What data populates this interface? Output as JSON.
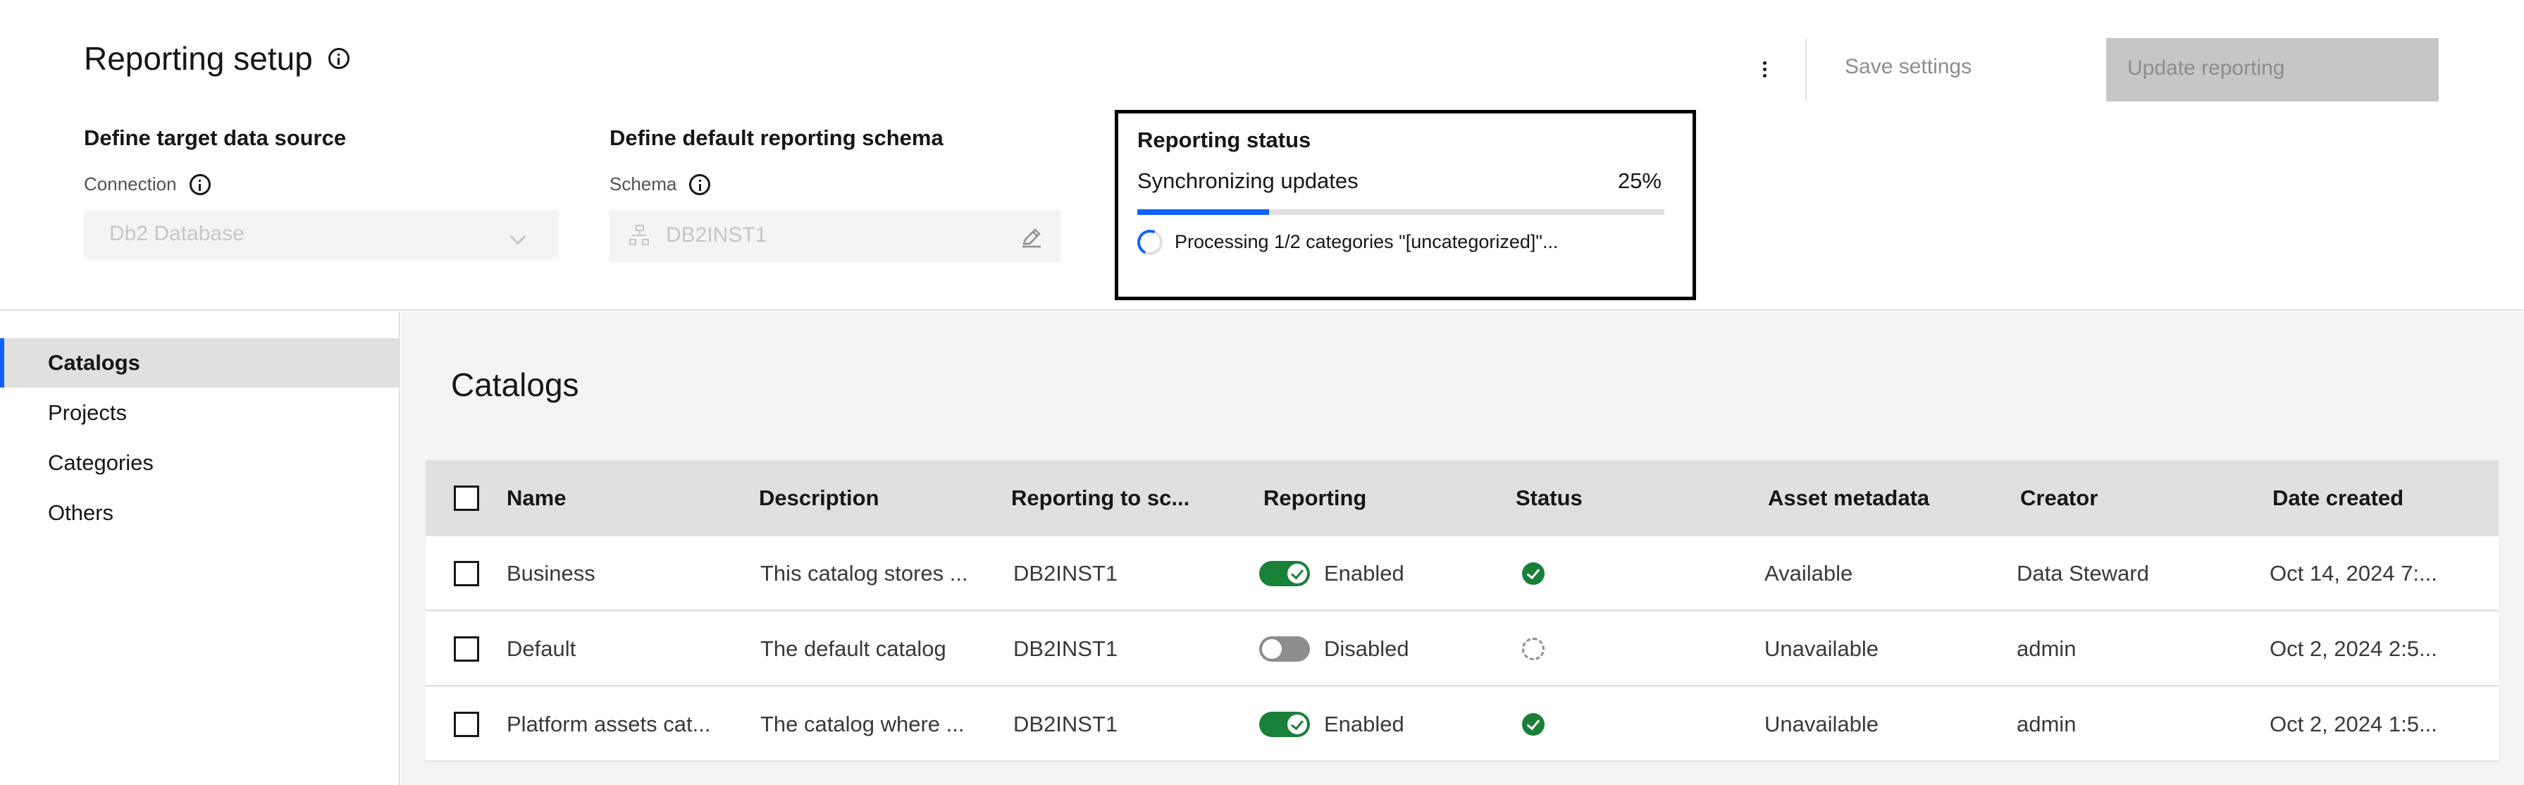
{
  "header": {
    "title": "Reporting setup",
    "save_label": "Save settings",
    "update_label": "Update reporting",
    "target": {
      "heading": "Define target data source",
      "field_label": "Connection",
      "value": "Db2 Database"
    },
    "schema": {
      "heading": "Define default reporting schema",
      "field_label": "Schema",
      "value": "DB2INST1"
    },
    "status_card": {
      "title": "Reporting status",
      "subtitle": "Synchronizing updates",
      "percent_text": "25%",
      "progress": 0.25,
      "message": "Processing 1/2 categories \"[uncategorized]\"..."
    }
  },
  "sidebar": {
    "items": [
      {
        "label": "Catalogs",
        "active": true
      },
      {
        "label": "Projects",
        "active": false
      },
      {
        "label": "Categories",
        "active": false
      },
      {
        "label": "Others",
        "active": false
      }
    ]
  },
  "main": {
    "title": "Catalogs",
    "columns": [
      "Name",
      "Description",
      "Reporting to sc...",
      "Reporting",
      "Status",
      "Asset metadata",
      "Creator",
      "Date created"
    ],
    "rows": [
      {
        "name": "Business",
        "description": "This catalog stores ...",
        "schema": "DB2INST1",
        "reporting": "Enabled",
        "reporting_on": true,
        "status": "synced",
        "asset_metadata": "Available",
        "creator": "Data Steward",
        "date": "Oct 14, 2024 7:..."
      },
      {
        "name": "Default",
        "description": "The default catalog",
        "schema": "DB2INST1",
        "reporting": "Disabled",
        "reporting_on": false,
        "status": "not-synced",
        "asset_metadata": "Unavailable",
        "creator": "admin",
        "date": "Oct 2, 2024 2:5..."
      },
      {
        "name": "Platform assets cat...",
        "description": "The catalog where ...",
        "schema": "DB2INST1",
        "reporting": "Enabled",
        "reporting_on": true,
        "status": "synced",
        "asset_metadata": "Unavailable",
        "creator": "admin",
        "date": "Oct 2, 2024 1:5..."
      }
    ]
  },
  "colors": {
    "accent": "#0f62fe",
    "success": "#198038",
    "disabled": "#c6c6c6",
    "toggle_off": "#8d8d8d"
  }
}
